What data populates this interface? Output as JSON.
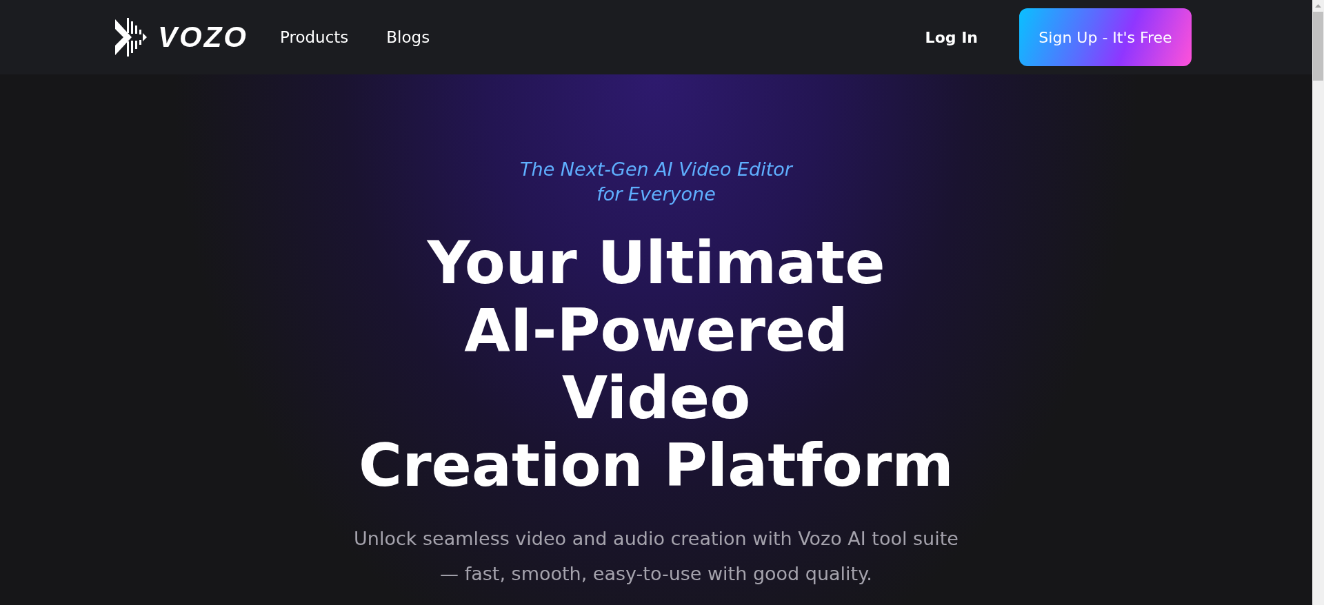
{
  "header": {
    "logo": "VOZO",
    "nav": [
      "Products",
      "Blogs"
    ],
    "login": "Log In",
    "signup": "Sign Up - It's Free"
  },
  "hero": {
    "tagline": [
      "The Next-Gen AI Video Editor",
      "for Everyone"
    ],
    "headline": [
      "Your Ultimate",
      "AI-Powered",
      "Video",
      "Creation Platform"
    ],
    "description": [
      "Unlock seamless video and audio creation with Vozo AI tool suite",
      "— fast, smooth, easy-to-use with good quality."
    ]
  }
}
